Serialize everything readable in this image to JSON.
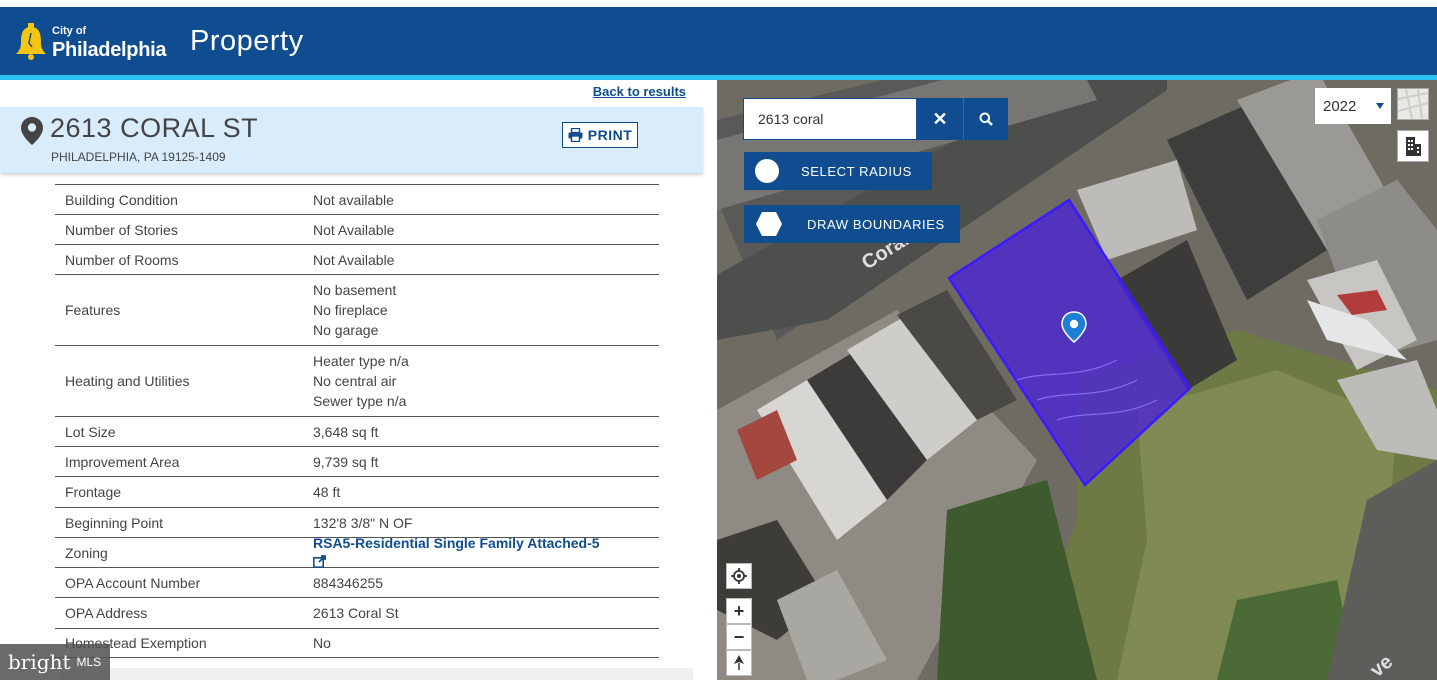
{
  "header": {
    "logo_city": "City of",
    "logo_name": "Philadelphia",
    "app_title": "Property",
    "colors": {
      "header_bg": "#0f4d90",
      "accent": "#2fc2f0"
    }
  },
  "left": {
    "back_link": "Back to results",
    "address": "2613 CORAL ST",
    "city_line": "PHILADELPHIA, PA 19125-1409",
    "print_label": "PRINT",
    "rows": [
      {
        "label": "Building Condition",
        "values": [
          "Not available"
        ]
      },
      {
        "label": "Number of Stories",
        "values": [
          "Not Available"
        ]
      },
      {
        "label": "Number of Rooms",
        "values": [
          "Not Available"
        ]
      },
      {
        "label": "Features",
        "values": [
          "No basement",
          "No fireplace",
          "No garage"
        ]
      },
      {
        "label": "Heating and Utilities",
        "values": [
          "Heater type n/a",
          "No central air",
          "Sewer type n/a"
        ]
      },
      {
        "label": "Lot Size",
        "values": [
          "3,648 sq ft"
        ]
      },
      {
        "label": "Improvement Area",
        "values": [
          "9,739 sq ft"
        ]
      },
      {
        "label": "Frontage",
        "values": [
          "48 ft"
        ]
      },
      {
        "label": "Beginning Point",
        "values": [
          "132'8 3/8\" N OF"
        ]
      },
      {
        "label": "Zoning",
        "link": "RSA5-Residential Single Family Attached-5"
      },
      {
        "label": "OPA Account Number",
        "values": [
          "884346255"
        ]
      },
      {
        "label": "OPA Address",
        "values": [
          "2613 Coral St"
        ]
      },
      {
        "label": "Homestead Exemption",
        "values": [
          "No"
        ]
      }
    ]
  },
  "watermark": {
    "brand": "bright",
    "suffix": "MLS"
  },
  "map": {
    "search_value": "2613 coral",
    "select_radius_label": "SELECT RADIUS",
    "draw_boundaries_label": "DRAW BOUNDARIES",
    "year": "2022",
    "street_label": "Coral",
    "street_label_2": "ve",
    "icons": [
      "search-icon",
      "close-icon",
      "locate-icon",
      "zoom-in-icon",
      "zoom-out-icon",
      "compass-icon",
      "building-icon",
      "map-pin-icon"
    ]
  }
}
